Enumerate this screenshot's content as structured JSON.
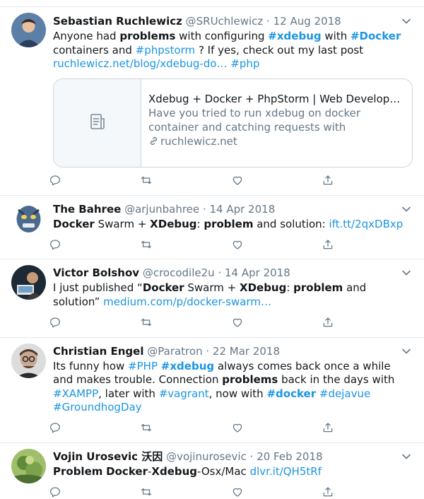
{
  "colors": {
    "link": "#1b95e0",
    "secondary": "#657786",
    "border": "#e6ecf0"
  },
  "tweets": [
    {
      "name": "Sebastian Ruchlewicz",
      "handle": "@SRUchlewicz",
      "date": "12 Aug 2018",
      "text": [
        {
          "t": "Anyone had "
        },
        {
          "t": "problems",
          "s": "b"
        },
        {
          "t": " with configuring "
        },
        {
          "t": "#xdebug",
          "s": "lb"
        },
        {
          "t": " with "
        },
        {
          "t": "#Docker",
          "s": "lb"
        },
        {
          "t": " containers and "
        },
        {
          "t": "#phpstorm",
          "s": "l"
        },
        {
          "t": " ? If yes, check out my last post "
        },
        {
          "t": "ruchlewicz.net/blog/xdebug-do…",
          "s": "l"
        },
        {
          "t": "  "
        },
        {
          "t": "#php",
          "s": "l"
        }
      ],
      "card": {
        "title": "Xdebug + Docker + PhpStorm | Web Develop…",
        "description": "Have you tried to run xdebug on docker container and catching requests with",
        "domain": "ruchlewicz.net"
      }
    },
    {
      "name": "The Bahree",
      "handle": "@arjunbahree",
      "date": "14 Apr 2018",
      "text": [
        {
          "t": "Docker",
          "s": "b"
        },
        {
          "t": " Swarm + "
        },
        {
          "t": "XDebug",
          "s": "b"
        },
        {
          "t": ": "
        },
        {
          "t": "problem",
          "s": "b"
        },
        {
          "t": " and solution: "
        },
        {
          "t": "ift.tt/2qxDBxp",
          "s": "l"
        }
      ]
    },
    {
      "name": "Victor Bolshov",
      "handle": "@crocodile2u",
      "date": "14 Apr 2018",
      "text": [
        {
          "t": "I just published “"
        },
        {
          "t": "Docker",
          "s": "b"
        },
        {
          "t": " Swarm + "
        },
        {
          "t": "XDebug",
          "s": "b"
        },
        {
          "t": ": "
        },
        {
          "t": "problem",
          "s": "b"
        },
        {
          "t": " and solution” "
        },
        {
          "t": "medium.com/p/docker-swarm…",
          "s": "l"
        }
      ]
    },
    {
      "name": "Christian Engel",
      "handle": "@Paratron",
      "date": "22 Mar 2018",
      "text": [
        {
          "t": "Its funny how "
        },
        {
          "t": "#PHP",
          "s": "l"
        },
        {
          "t": " "
        },
        {
          "t": "#xdebug",
          "s": "lb"
        },
        {
          "t": " always comes back once a while and makes trouble. Connection "
        },
        {
          "t": "problems",
          "s": "b"
        },
        {
          "t": " back in the days with "
        },
        {
          "t": "#XAMPP",
          "s": "l"
        },
        {
          "t": ", later with "
        },
        {
          "t": "#vagrant",
          "s": "l"
        },
        {
          "t": ", now with "
        },
        {
          "t": "#docker",
          "s": "lb"
        },
        {
          "t": " "
        },
        {
          "t": "#dejavue",
          "s": "l"
        },
        {
          "t": " "
        },
        {
          "t": "#GroundhogDay",
          "s": "l"
        }
      ]
    },
    {
      "name": "Vojin Urosevic 沃因",
      "handle": "@vojinurosevic",
      "date": "20 Feb 2018",
      "text": [
        {
          "t": "Problem",
          "s": "b"
        },
        {
          "t": " "
        },
        {
          "t": "Docker",
          "s": "b"
        },
        {
          "t": "-"
        },
        {
          "t": "Xdebug",
          "s": "b"
        },
        {
          "t": "-Osx/Mac "
        },
        {
          "t": "dlvr.it/QH5tRf",
          "s": "l"
        }
      ]
    }
  ],
  "separator": "·",
  "icons": [
    "reply-icon",
    "retweet-icon",
    "like-icon",
    "share-icon",
    "chevron-down-icon",
    "link-icon",
    "document-icon"
  ]
}
